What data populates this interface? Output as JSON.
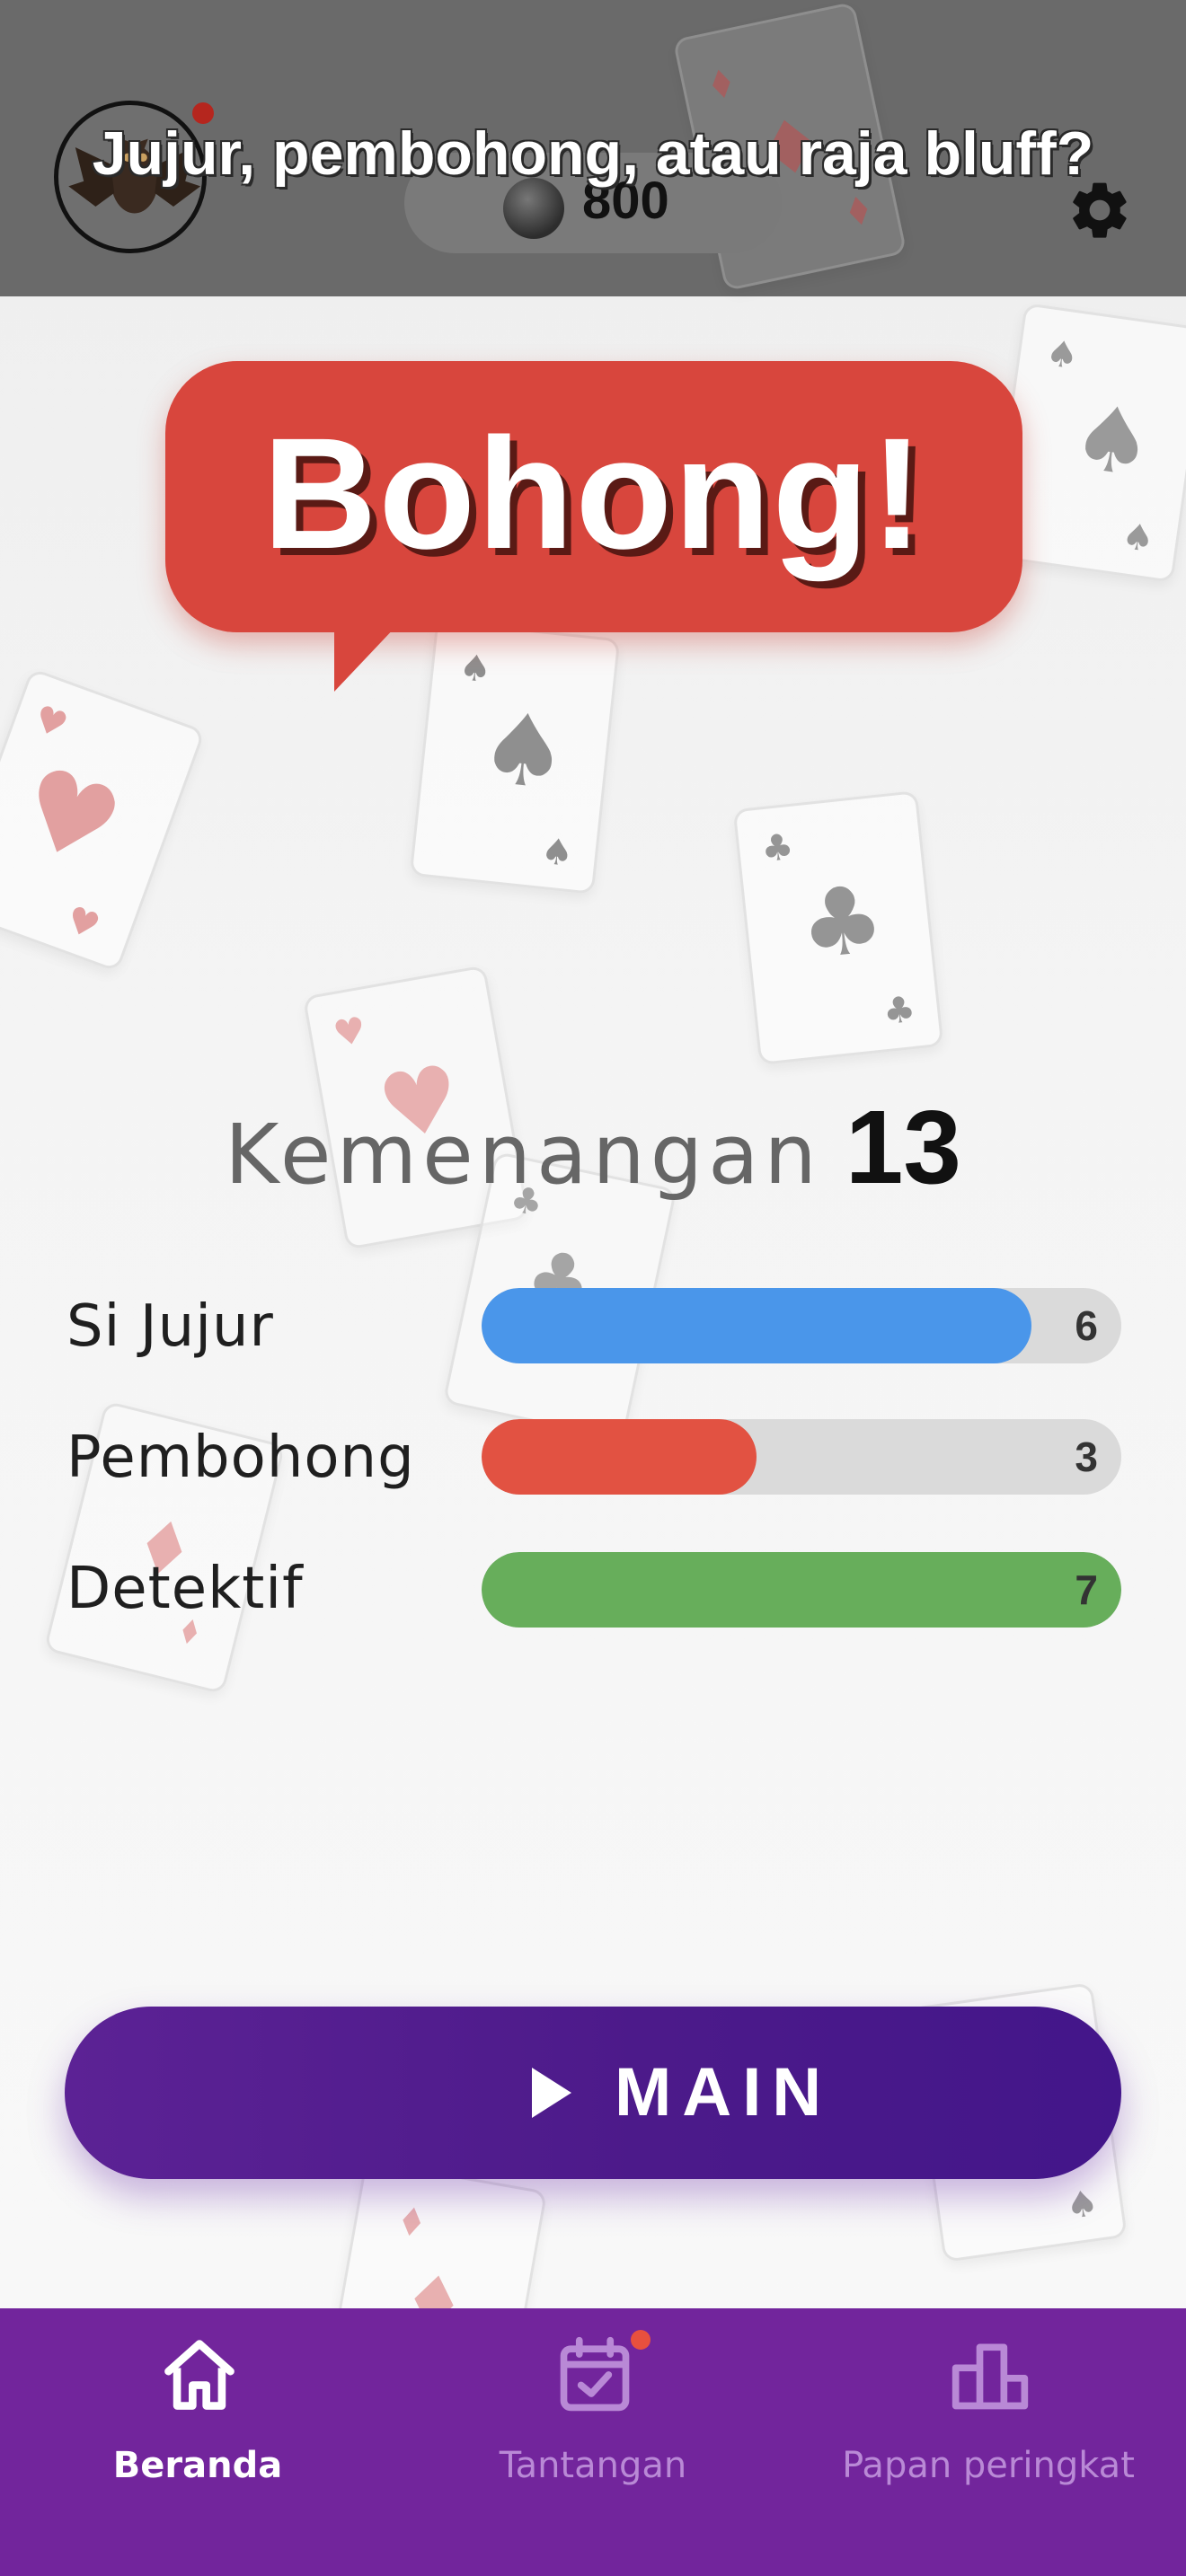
{
  "header": {
    "title": "Jujur, pembohong, atau raja bluff?",
    "coins": "800",
    "avatar_icon": "bat-icon",
    "settings_icon": "gear-icon"
  },
  "bubble": {
    "text": "Bohong!"
  },
  "wins": {
    "label": "Kemenangan",
    "value": "13"
  },
  "stats": [
    {
      "label": "Si Jujur",
      "value": "6",
      "fraction": 0.86,
      "color": "#4a96ea"
    },
    {
      "label": "Pembohong",
      "value": "3",
      "fraction": 0.43,
      "color": "#e25242"
    },
    {
      "label": "Detektif",
      "value": "7",
      "fraction": 1.0,
      "color": "#67ae5b"
    }
  ],
  "main_button": {
    "label": "MAIN",
    "icon": "play-icon"
  },
  "nav": {
    "items": [
      {
        "label": "Beranda",
        "icon": "home-icon",
        "active": true
      },
      {
        "label": "Tantangan",
        "icon": "calendar-check-icon",
        "active": false,
        "badge": true
      },
      {
        "label": "Papan peringkat",
        "icon": "leaderboard-icon",
        "active": false
      }
    ]
  },
  "colors": {
    "header_bg": "#6a6a6a",
    "bubble": "#d8463d",
    "main_button": "#4c1a8a",
    "nav_bg": "#72259c"
  }
}
